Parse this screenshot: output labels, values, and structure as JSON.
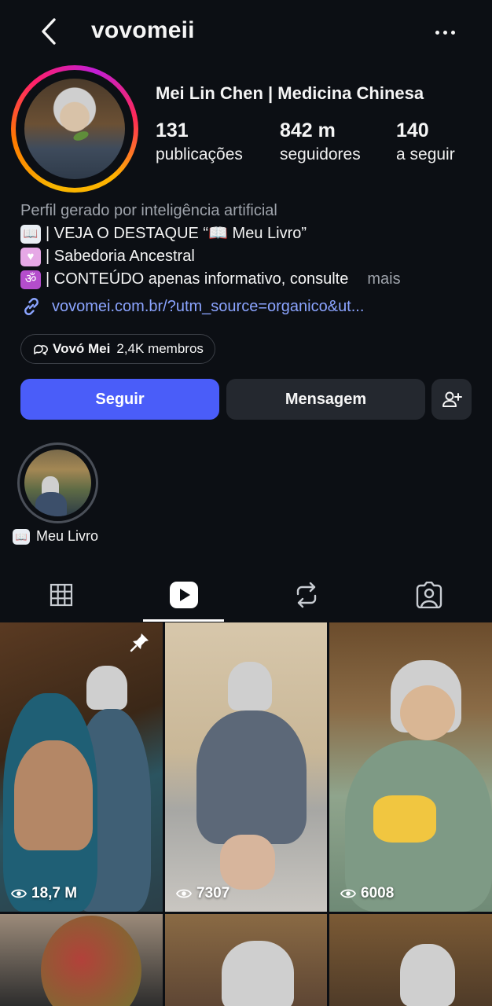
{
  "header": {
    "username": "vovomeii"
  },
  "profile": {
    "full_name": "Mei Lin Chen | Medicina Chinesa",
    "stats": [
      {
        "value": "131",
        "label": "publicações"
      },
      {
        "value": "842 m",
        "label": "seguidores"
      },
      {
        "value": "140",
        "label": "a seguir"
      }
    ],
    "bio": {
      "ai_notice": "Perfil gerado por inteligência artificial",
      "line1": "| VEJA O DESTAQUE “📖 Meu Livro”",
      "line2": "| Sabedoria Ancestral",
      "line3": "| CONTEÚDO apenas informativo, consulte",
      "more": "mais"
    },
    "link": "vovomei.com.br/?utm_source=organico&ut..."
  },
  "community": {
    "name": "Vovó Mei",
    "members": "2,4K membros"
  },
  "buttons": {
    "follow": "Seguir",
    "message": "Mensagem"
  },
  "highlights": [
    {
      "label": "Meu Livro"
    }
  ],
  "grid": [
    {
      "views": "18,7 M",
      "pinned": true
    },
    {
      "views": "7307",
      "pinned": false
    },
    {
      "views": "6008",
      "pinned": false
    },
    {
      "views": "",
      "pinned": false
    },
    {
      "views": "",
      "pinned": false
    },
    {
      "views": "",
      "pinned": false
    }
  ],
  "colors": {
    "follow_button": "#4a5df9",
    "link": "#8ba4ff",
    "background": "#0c0f14"
  }
}
